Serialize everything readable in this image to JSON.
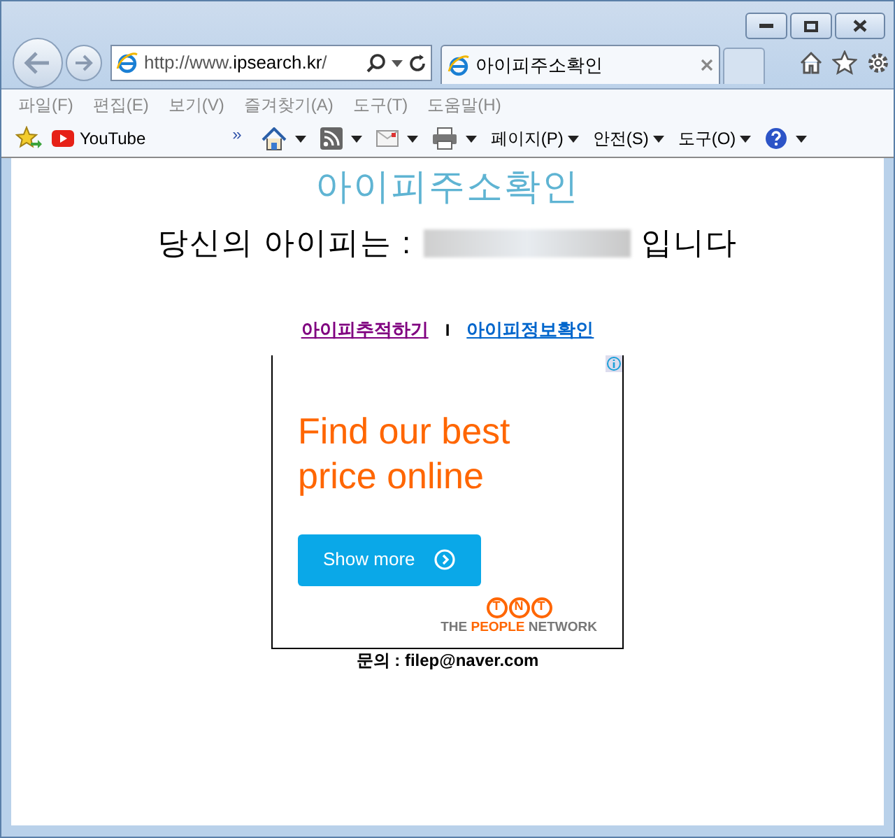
{
  "address_bar": {
    "url_prefix": "http://www.",
    "url_domain": "ipsearch.kr",
    "url_suffix": "/"
  },
  "tabs": [
    {
      "label": "아이피주소확인",
      "selected": true
    }
  ],
  "menu": [
    "파일(F)",
    "편집(E)",
    "보기(V)",
    "즐겨찾기(A)",
    "도구(T)",
    "도움말(H)"
  ],
  "favorites": [
    {
      "label": "YouTube"
    }
  ],
  "overflow": "»",
  "command_bar": [
    {
      "kind": "home"
    },
    {
      "kind": "feed"
    },
    {
      "kind": "mail"
    },
    {
      "kind": "print"
    },
    {
      "kind": "menu",
      "label": "페이지(P)"
    },
    {
      "kind": "menu",
      "label": "안전(S)"
    },
    {
      "kind": "menu",
      "label": "도구(O)"
    },
    {
      "kind": "help"
    }
  ],
  "page": {
    "title": "아이피주소확인",
    "ip_prefix": "당신의 아이피는 :",
    "ip_suffix": "입니다",
    "links": [
      {
        "label": "아이피추적하기",
        "visited": true
      },
      {
        "label": "아이피정보확인",
        "visited": false
      }
    ],
    "separator": "I",
    "ad": {
      "headline": "Find our best price online",
      "button": "Show more",
      "logo_letters": [
        "T",
        "N",
        "T"
      ],
      "tagline": [
        {
          "text": "THE ",
          "accent": false
        },
        {
          "text": "PEOPLE",
          "accent": true
        },
        {
          "text": " NETWORK",
          "accent": false
        }
      ]
    },
    "contact": "문의 : filep@naver.com"
  }
}
